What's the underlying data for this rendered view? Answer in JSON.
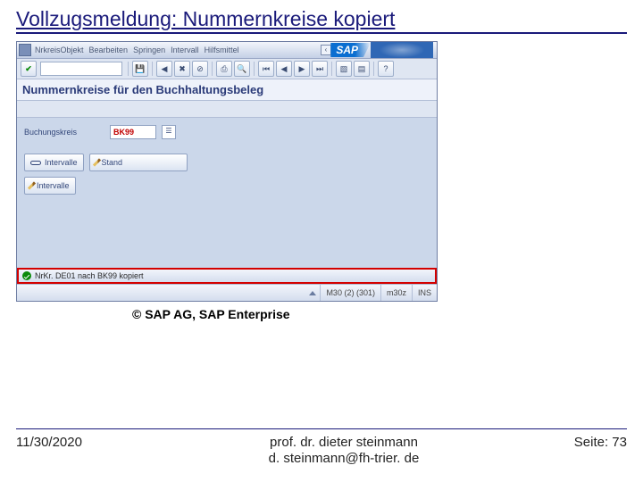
{
  "slide": {
    "title": "Vollzugsmeldung: Nummernkreise kopiert",
    "caption": "© SAP AG, SAP Enterprise"
  },
  "sap": {
    "logo": "SAP",
    "menu": {
      "m1": "NrkreisObjekt",
      "m2": "Bearbeiten",
      "m3": "Springen",
      "m4": "Intervall",
      "m5": "Hilfsmittel"
    },
    "page_title": "Nummernkreise für den Buchhaltungsbeleg",
    "form": {
      "company_label": "Buchungskreis",
      "company_value": "BK99"
    },
    "buttons": {
      "intervals_display": "Intervalle",
      "status": "Stand",
      "intervals_edit": "Intervalle"
    },
    "status_msg": "NrKr. DE01 nach BK99 kopiert",
    "sys": {
      "client": "M30 (2) (301)",
      "server": "m30z",
      "mode": "INS"
    }
  },
  "footer": {
    "date": "11/30/2020",
    "author_line1": "prof. dr. dieter steinmann",
    "author_line2": "d. steinmann@fh-trier. de",
    "page": "Seite: 73"
  }
}
